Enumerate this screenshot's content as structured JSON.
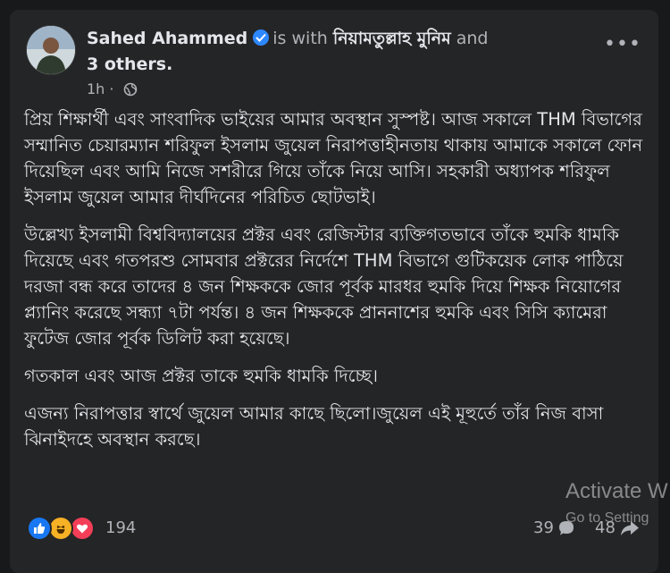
{
  "post": {
    "author": "Sahed Ahammed",
    "is_with_label": "is with",
    "tagged_person": "নিয়ামতুল্লাহ মুনিম",
    "and_label": "and",
    "others": "3 others.",
    "time": "1h",
    "separator": "·",
    "privacy_icon": "globe-icon",
    "more_label": "•••",
    "paragraphs": [
      "প্রিয় শিক্ষার্থী এবং সাংবাদিক ভাইয়ের আমার অবস্থান সুস্পষ্ট। আজ সকালে THM বিভাগের সম্মানিত চেয়ারম্যান শরিফুল ইসলাম জুয়েল নিরাপত্তাহীনতায় থাকায় আমাকে সকালে ফোন দিয়েছিল এবং আমি নিজে সশরীরে গিয়ে তাঁকে নিয়ে আসি। সহকারী অধ্যাপক শরিফুল ইসলাম জুয়েল আমার দীর্ঘদিনের পরিচিত ছোটভাই।",
      "উল্লেখ্য ইসলামী বিশ্ববিদ্যালয়ের প্রক্টর এবং রেজিস্টার ব্যক্তিগতভাবে তাঁকে হুমকি ধামকি দিয়েছে এবং গতপরশু সোমবার প্রক্টরের নির্দেশে THM বিভাগে গুটিকয়েক লোক পাঠিয়ে দরজা বন্ধ করে তাদের ৪ জন শিক্ষককে জোর পূর্বক মারধর হুমকি দিয়ে শিক্ষক নিয়োগের প্ল্যানিং করেছে  সন্ধ্যা ৭টা পর্যন্ত। ৪ জন শিক্ষককে প্রাননাশের হুমকি এবং সিসি ক্যামেরা ফুটেজ জোর পূর্বক ডিলিট করা হয়েছে।",
      "গতকাল এবং আজ প্রক্টর তাকে হুমকি ধামকি দিচ্ছে।",
      "এজন্য নিরাপত্তার স্বার্থে জুয়েল আমার কাছে ছিলো।জুয়েল এই মূহুর্তে তাঁর নিজ বাসা ঝিনাইদহে অবস্থান করছে।"
    ]
  },
  "footer": {
    "reaction_icons": [
      "like-icon",
      "haha-icon",
      "love-icon"
    ],
    "reaction_count": "194",
    "comment_count": "39",
    "share_count": "48"
  },
  "watermark": {
    "title": "Activate W",
    "subtitle": "Go to Setting"
  },
  "colors": {
    "background": "#18191a",
    "card": "#242526",
    "text": "#e4e6eb",
    "secondary_text": "#b0b3b8",
    "verified": "#2d88ff",
    "like": "#1877f2",
    "haha": "#f7b125",
    "love": "#f33e58"
  }
}
